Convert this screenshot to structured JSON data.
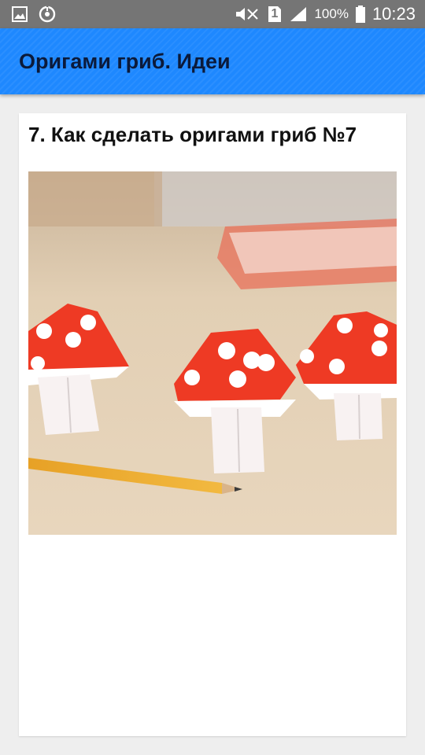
{
  "status_bar": {
    "icons": [
      "image-icon",
      "sync-icon",
      "mute-icon",
      "sim-icon",
      "signal-icon",
      "battery-icon"
    ],
    "sim_slot": "1",
    "battery_percent": "100%",
    "time": "10:23"
  },
  "app_bar": {
    "title": "Оригами гриб. Идеи",
    "color": "#1e88ff"
  },
  "card": {
    "title": "7. Как сделать оригами гриб №7",
    "image_subject": "origami mushroom illustration"
  }
}
